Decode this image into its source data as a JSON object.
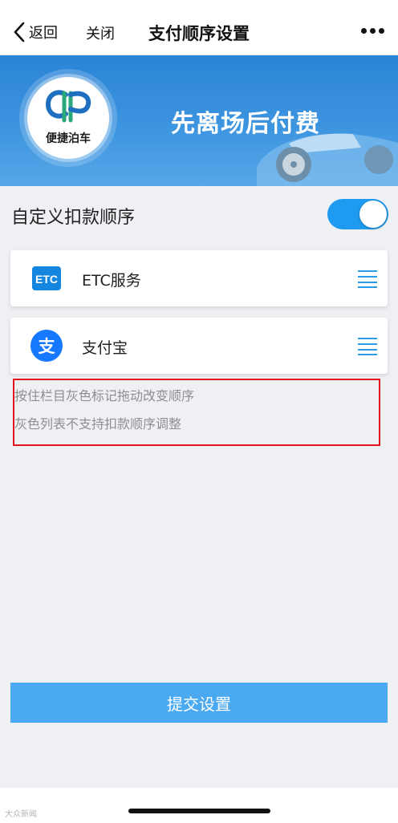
{
  "nav": {
    "back_label": "返回",
    "close_label": "关闭",
    "title": "支付顺序设置"
  },
  "banner": {
    "logo_text": "便捷泊车",
    "title": "先离场后付费"
  },
  "custom_order": {
    "label": "自定义扣款顺序",
    "toggle_on": true
  },
  "payment_methods": [
    {
      "label": "ETC服务",
      "icon": "etc-icon",
      "icon_text": "ETC"
    },
    {
      "label": "支付宝",
      "icon": "alipay-icon",
      "icon_text": "支"
    }
  ],
  "notes": {
    "line1": "按住栏目灰色标记拖动改变顺序",
    "line2": "灰色列表不支持扣款顺序调整"
  },
  "submit_label": "提交设置",
  "watermark": "大众新闻",
  "colors": {
    "accent": "#1e9bf0",
    "submit": "#4aa9f0",
    "banner": "#2b83d6",
    "highlight_border": "#e3141c"
  }
}
